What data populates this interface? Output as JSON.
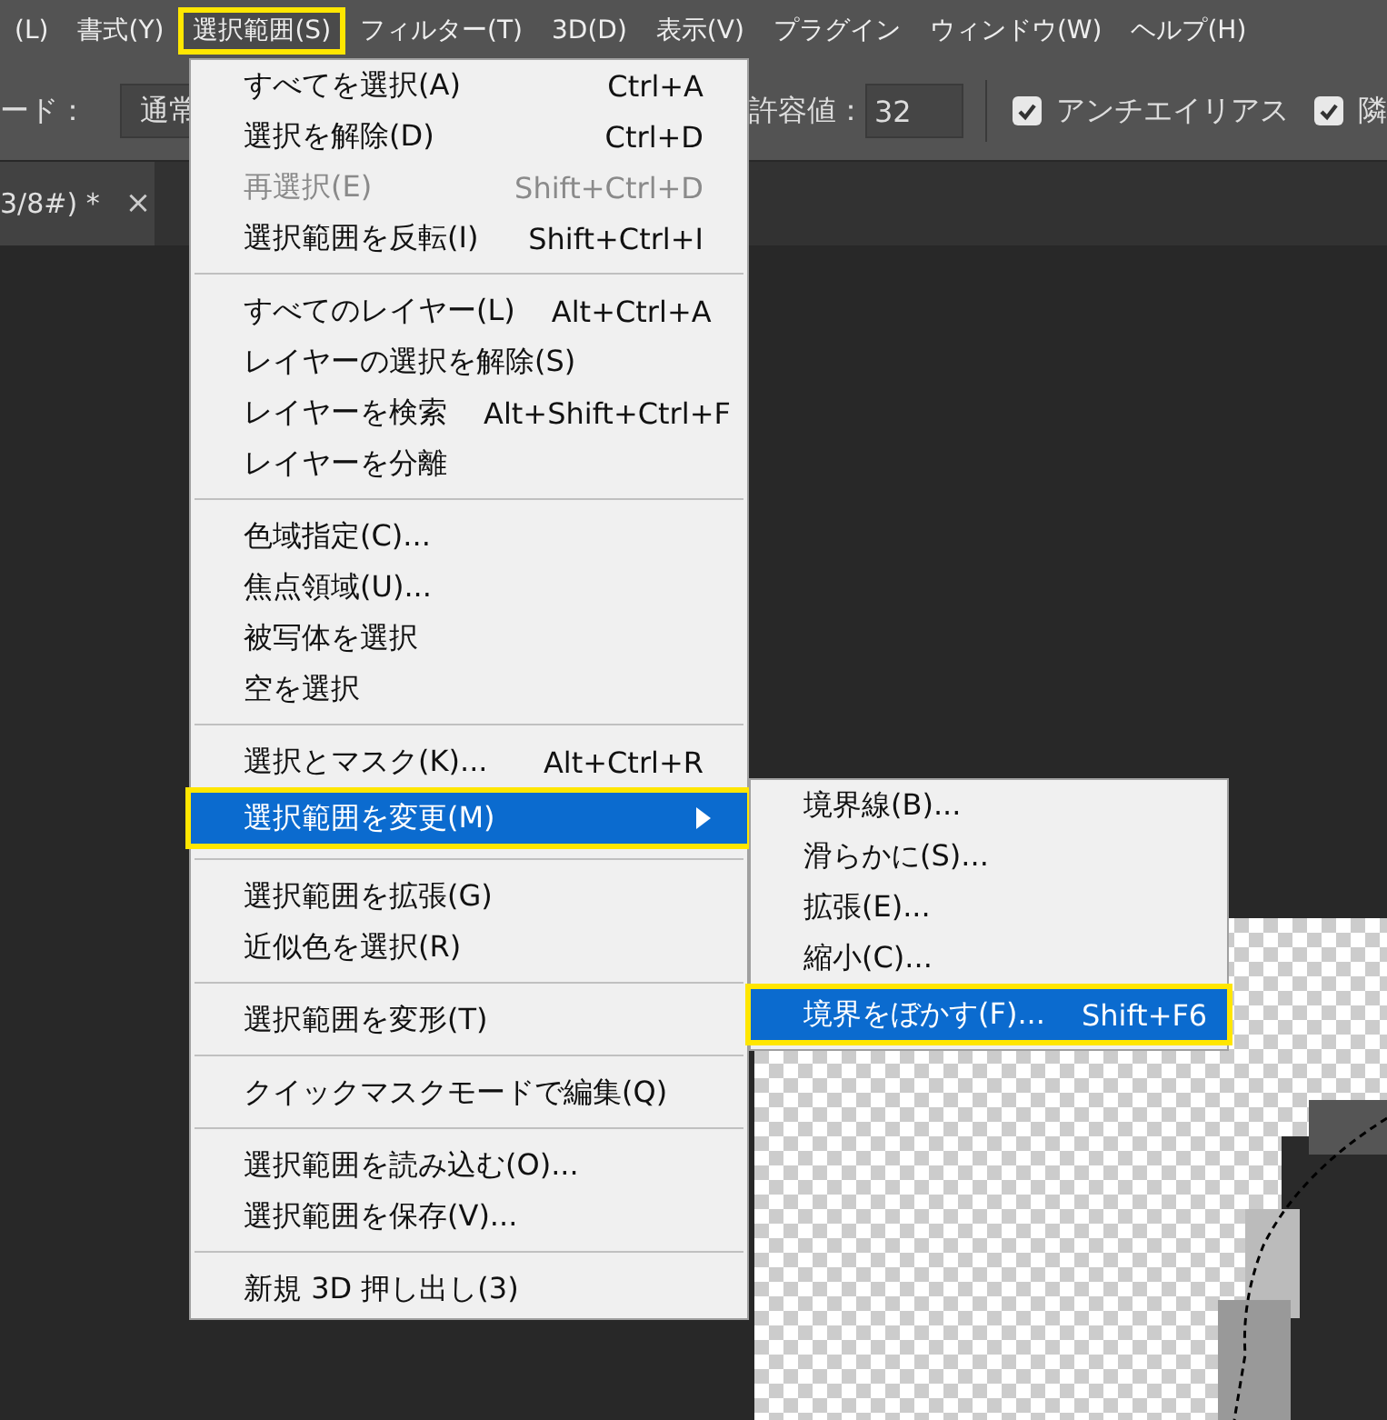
{
  "menubar": {
    "items": [
      {
        "label": "(L)",
        "selected": false
      },
      {
        "label": "書式(Y)",
        "selected": false
      },
      {
        "label": "選択範囲(S)",
        "selected": true
      },
      {
        "label": "フィルター(T)",
        "selected": false
      },
      {
        "label": "3D(D)",
        "selected": false
      },
      {
        "label": "表示(V)",
        "selected": false
      },
      {
        "label": "プラグイン",
        "selected": false
      },
      {
        "label": "ウィンドウ(W)",
        "selected": false
      },
      {
        "label": "ヘルプ(H)",
        "selected": false
      }
    ]
  },
  "options_bar": {
    "mode_label": "ード：",
    "mode_value": "通常",
    "tolerance_label": "許容値：",
    "tolerance_value": "32",
    "checkboxes": [
      {
        "label": "アンチエイリアス",
        "checked": true
      },
      {
        "label": "隣",
        "checked": true
      }
    ]
  },
  "document_tab": {
    "label": "3/8#) *",
    "close": "×"
  },
  "menu": {
    "groups": [
      [
        {
          "kind": "command",
          "label": "すべてを選択(A)",
          "shortcut": "Ctrl+A",
          "disabled": false,
          "selected": false
        },
        {
          "kind": "command",
          "label": "選択を解除(D)",
          "shortcut": "Ctrl+D",
          "disabled": false,
          "selected": false
        },
        {
          "kind": "command",
          "label": "再選択(E)",
          "shortcut": "Shift+Ctrl+D",
          "disabled": true,
          "selected": false
        },
        {
          "kind": "command",
          "label": "選択範囲を反転(I)",
          "shortcut": "Shift+Ctrl+I",
          "disabled": false,
          "selected": false
        }
      ],
      [
        {
          "kind": "command",
          "label": "すべてのレイヤー(L)",
          "shortcut": "Alt+Ctrl+A",
          "disabled": false,
          "selected": false
        },
        {
          "kind": "command",
          "label": "レイヤーの選択を解除(S)",
          "disabled": false,
          "selected": false
        },
        {
          "kind": "command",
          "label": "レイヤーを検索",
          "shortcut": "Alt+Shift+Ctrl+F",
          "disabled": false,
          "selected": false
        },
        {
          "kind": "command",
          "label": "レイヤーを分離",
          "disabled": false,
          "selected": false
        }
      ],
      [
        {
          "kind": "command",
          "label": "色域指定(C)...",
          "disabled": false,
          "selected": false
        },
        {
          "kind": "command",
          "label": "焦点領域(U)...",
          "disabled": false,
          "selected": false
        },
        {
          "kind": "command",
          "label": "被写体を選択",
          "disabled": false,
          "selected": false
        },
        {
          "kind": "command",
          "label": "空を選択",
          "disabled": false,
          "selected": false
        }
      ],
      [
        {
          "kind": "command",
          "label": "選択とマスク(K)...",
          "shortcut": "Alt+Ctrl+R",
          "disabled": false,
          "selected": false
        },
        {
          "kind": "submenu",
          "label": "選択範囲を変更(M)",
          "disabled": false,
          "selected": true
        }
      ],
      [
        {
          "kind": "command",
          "label": "選択範囲を拡張(G)",
          "disabled": false,
          "selected": false
        },
        {
          "kind": "command",
          "label": "近似色を選択(R)",
          "disabled": false,
          "selected": false
        }
      ],
      [
        {
          "kind": "command",
          "label": "選択範囲を変形(T)",
          "disabled": false,
          "selected": false
        }
      ],
      [
        {
          "kind": "command",
          "label": "クイックマスクモードで編集(Q)",
          "disabled": false,
          "selected": false
        }
      ],
      [
        {
          "kind": "command",
          "label": "選択範囲を読み込む(O)...",
          "disabled": false,
          "selected": false
        },
        {
          "kind": "command",
          "label": "選択範囲を保存(V)...",
          "disabled": false,
          "selected": false
        }
      ],
      [
        {
          "kind": "command",
          "label": "新規 3D 押し出し(3)",
          "disabled": false,
          "selected": false
        }
      ]
    ]
  },
  "submenu": {
    "groups": [
      [
        {
          "kind": "command",
          "label": "境界線(B)...",
          "disabled": false,
          "selected": false
        },
        {
          "kind": "command",
          "label": "滑らかに(S)...",
          "disabled": false,
          "selected": false
        },
        {
          "kind": "command",
          "label": "拡張(E)...",
          "disabled": false,
          "selected": false
        },
        {
          "kind": "command",
          "label": "縮小(C)...",
          "disabled": false,
          "selected": false
        },
        {
          "kind": "command",
          "label": "境界をぼかす(F)...",
          "shortcut": "Shift+F6",
          "disabled": false,
          "selected": true
        }
      ]
    ]
  }
}
